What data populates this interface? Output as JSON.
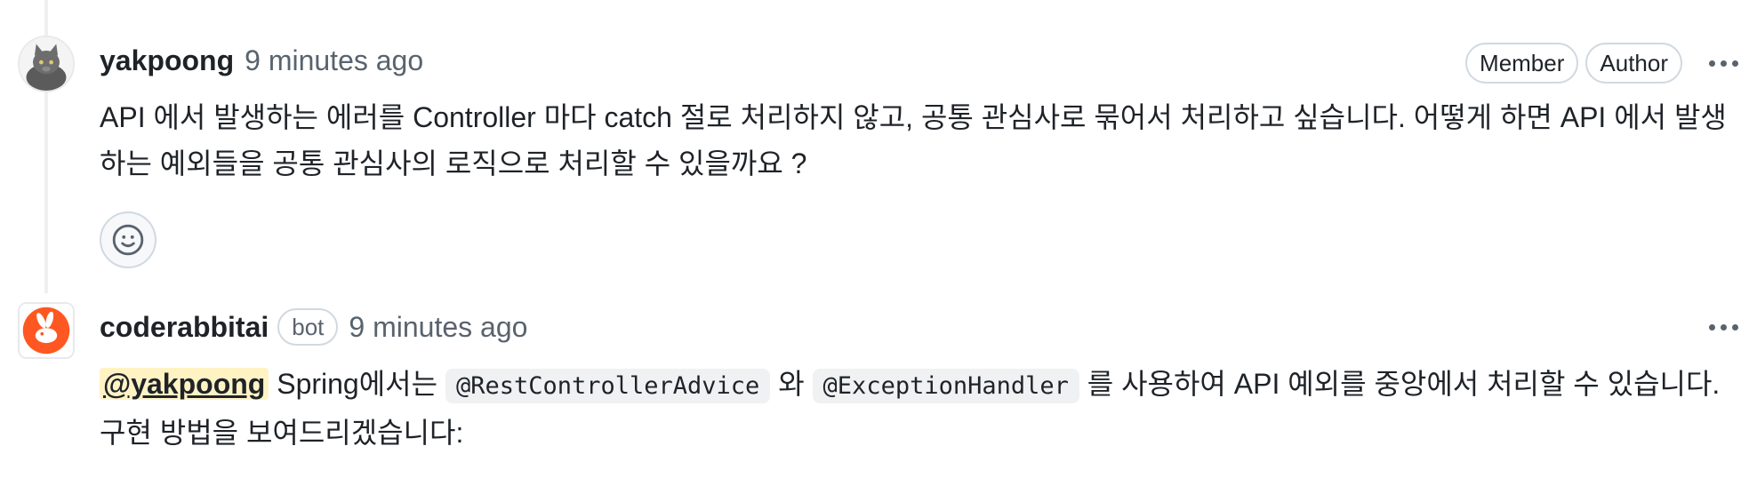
{
  "comments": [
    {
      "author": "yakpoong",
      "time": "9 minutes ago",
      "badges": [
        "Member",
        "Author"
      ],
      "body": "API 에서 발생하는 에러를 Controller 마다 catch 절로 처리하지 않고, 공통 관심사로 묶어서 처리하고 싶습니다. 어떻게 하면 API 에서 발생하는 예외들을 공통 관심사의 로직으로 처리할 수 있을까요 ?",
      "avatar_icon": "gray-cat-avatar",
      "reaction_icon": "smiley-icon"
    },
    {
      "author": "coderabbitai",
      "bot_label": "bot",
      "time": "9 minutes ago",
      "mention": "@yakpoong",
      "body_part1": " Spring에서는 ",
      "code1": "@RestControllerAdvice",
      "body_part2": " 와 ",
      "code2": "@ExceptionHandler",
      "body_part3": " 를 사용하여 API 예외를 중앙에서 처리할 수 있습니다. 구현 방법을 보여드리겠습니다:",
      "avatar_icon": "rabbit-logo-avatar",
      "brand_color": "#ff5722"
    }
  ]
}
